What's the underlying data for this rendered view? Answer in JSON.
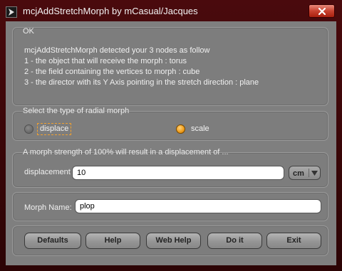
{
  "window": {
    "title": "mcjAddStretchMorph by mCasual/Jacques",
    "app_icon": "daz-arrow-icon",
    "close_icon": "close-x-icon"
  },
  "info": {
    "title": "OK",
    "lines": [
      "mcjAddStretchMorph detected your 3 nodes as follow",
      "1 - the object that will receive the morph : torus",
      "2 - the field containing the vertices to morph : cube",
      "3 - the director with its Y Axis pointing in the stretch direction : plane"
    ]
  },
  "radial": {
    "title": "Select the type of radial morph",
    "options": [
      {
        "label": "displace",
        "selected": false
      },
      {
        "label": "scale",
        "selected": true
      }
    ]
  },
  "strength": {
    "title": "A morph strength of 100% will result in a displacement of ...",
    "label": "displacement",
    "value": "10",
    "unit": "cm"
  },
  "morph": {
    "label": "Morph Name:",
    "value": "plop"
  },
  "buttons": [
    "Defaults",
    "Help",
    "Web Help",
    "Do it",
    "Exit"
  ],
  "colors": {
    "frame": "#3a0608",
    "client": "#7f7f7f",
    "radio_selected": "#f0a020"
  }
}
